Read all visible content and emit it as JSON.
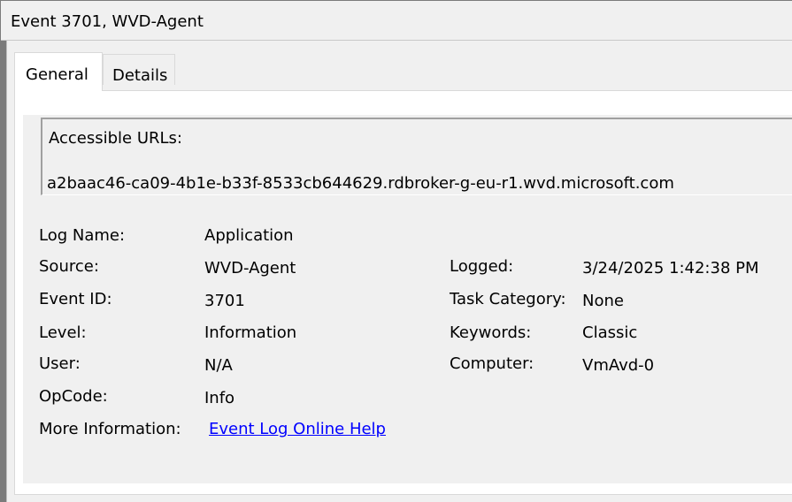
{
  "window": {
    "title": "Event 3701, WVD-Agent"
  },
  "tabs": [
    {
      "label": "General",
      "active": true
    },
    {
      "label": "Details",
      "active": false
    }
  ],
  "description": {
    "line1": "Accessible URLs:",
    "line2": "a2baac46-ca09-4b1e-b33f-8533cb644629.rdbroker-g-eu-r1.wvd.microsoft.com"
  },
  "fields": {
    "log_name": {
      "label": "Log Name:",
      "value": "Application"
    },
    "source": {
      "label": "Source:",
      "value": "WVD-Agent"
    },
    "event_id": {
      "label": "Event ID:",
      "value": "3701"
    },
    "level": {
      "label": "Level:",
      "value": "Information"
    },
    "user": {
      "label": "User:",
      "value": "N/A"
    },
    "opcode": {
      "label": "OpCode:",
      "value": "Info"
    },
    "more_info": {
      "label": "More Information:",
      "value": "Event Log Online Help"
    },
    "logged": {
      "label": "Logged:",
      "value": "3/24/2025 1:42:38 PM"
    },
    "task_category": {
      "label": "Task Category:",
      "value": "None"
    },
    "keywords": {
      "label": "Keywords:",
      "value": "Classic"
    },
    "computer": {
      "label": "Computer:",
      "value": "VmAvd-0"
    }
  },
  "colors": {
    "link": "#0000ff",
    "panel_bg": "#f0f0f0"
  }
}
